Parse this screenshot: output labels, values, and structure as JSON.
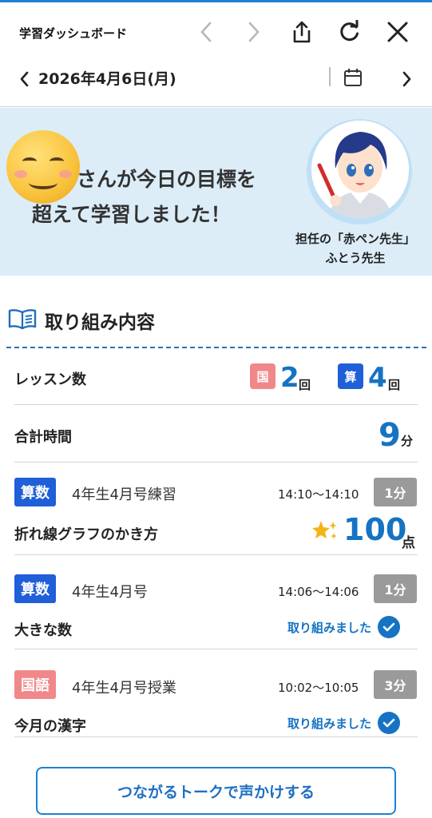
{
  "header": {
    "title": "学習ダッシュボード",
    "icons": [
      "back-icon",
      "forward-icon",
      "share-icon",
      "reload-icon",
      "close-icon"
    ]
  },
  "datebar": {
    "date": "2026年4月6日(月)",
    "icons": [
      "chevron-left-icon",
      "calendar-icon",
      "chevron-right-icon"
    ]
  },
  "banner": {
    "line1": "さんが今日の目標を",
    "line2": "超えて学習しました！",
    "teacher_line1": "担任の「赤ペン先生」",
    "teacher_line2": "ふとう先生"
  },
  "section": {
    "title": "取り組み内容"
  },
  "summary": {
    "lessons_label": "レッスン数",
    "japanese_badge": "国",
    "japanese_count": "2",
    "math_badge": "算",
    "math_count": "4",
    "count_unit": "回",
    "total_time_label": "合計時間",
    "total_time_value": "9",
    "time_unit": "分"
  },
  "lessons": [
    {
      "subject": "算数",
      "name": "4年生4月号練習",
      "time": "14:10〜14:10",
      "duration": "1分",
      "topic": "折れ線グラフのかき方",
      "score": "100",
      "score_unit": "点"
    },
    {
      "subject": "算数",
      "name": "4年生4月号",
      "time": "14:06〜14:06",
      "duration": "1分",
      "topic": "大きな数",
      "status": "取り組みました"
    },
    {
      "subject": "国語",
      "name": "4年生4月号授業",
      "time": "10:02〜10:05",
      "duration": "3分",
      "topic": "今月の漢字",
      "status": "取り組みました"
    }
  ],
  "footer": {
    "talk_button": "つながるトークで声かけする"
  },
  "colors": {
    "accent_blue": "#1673c4",
    "math_blue": "#1f5fd8",
    "japanese_pink": "#f0888a",
    "banner_bg": "#dcedf8",
    "duration_gray": "#9a9a9a"
  }
}
